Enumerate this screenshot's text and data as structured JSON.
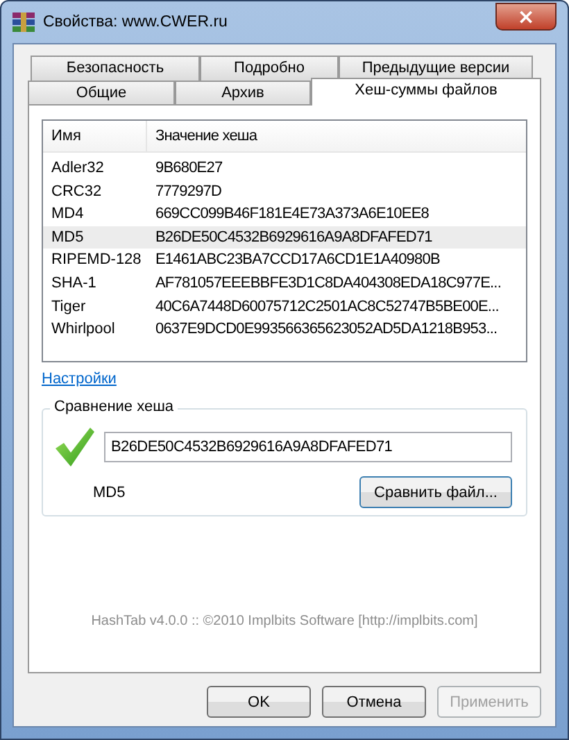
{
  "window": {
    "title": "Свойства: www.CWER.ru",
    "close": "×"
  },
  "tabs": [
    [
      {
        "label": "Безопасность",
        "selected": false
      },
      {
        "label": "Подробно",
        "selected": false
      },
      {
        "label": "Предыдущие версии",
        "selected": false
      }
    ],
    [
      {
        "label": "Общие",
        "selected": false
      },
      {
        "label": "Архив",
        "selected": false
      },
      {
        "label": "Хеш-суммы файлов",
        "selected": true
      }
    ]
  ],
  "table": {
    "columns": [
      "Имя",
      "Значение хеша"
    ],
    "rows": [
      {
        "name": "Adler32",
        "value": "9B680E27",
        "selected": false
      },
      {
        "name": "CRC32",
        "value": "7779297D",
        "selected": false
      },
      {
        "name": "MD4",
        "value": "669CC099B46F181E4E73A373A6E10EE8",
        "selected": false
      },
      {
        "name": "MD5",
        "value": "B26DE50C4532B6929616A9A8DFAFED71",
        "selected": true
      },
      {
        "name": "RIPEMD-128",
        "value": "E1461ABC23BA7CCD17A6CD1E1A40980B",
        "selected": false
      },
      {
        "name": "SHA-1",
        "value": "AF781057EEEBBFE3D1C8DA404308EDA18C977E...",
        "selected": false
      },
      {
        "name": "Tiger",
        "value": "40C6A7448D60075712C2501AC8C52747B5BE00E...",
        "selected": false
      },
      {
        "name": "Whirlpool",
        "value": "0637E9DCD0E993566365623052AD5DA1218B953...",
        "selected": false
      }
    ]
  },
  "settings_link": "Настройки",
  "compare": {
    "title": "Сравнение хеша",
    "value": "B26DE50C4532B6929616A9A8DFAFED71",
    "algorithm": "MD5",
    "button": "Сравнить файл..."
  },
  "footer": "HashTab v4.0.0 :: ©2010 Implbits Software [http://implbits.com]",
  "buttons": [
    {
      "label": "OK",
      "disabled": false
    },
    {
      "label": "Отмена",
      "disabled": false
    },
    {
      "label": "Применить",
      "disabled": true
    }
  ]
}
